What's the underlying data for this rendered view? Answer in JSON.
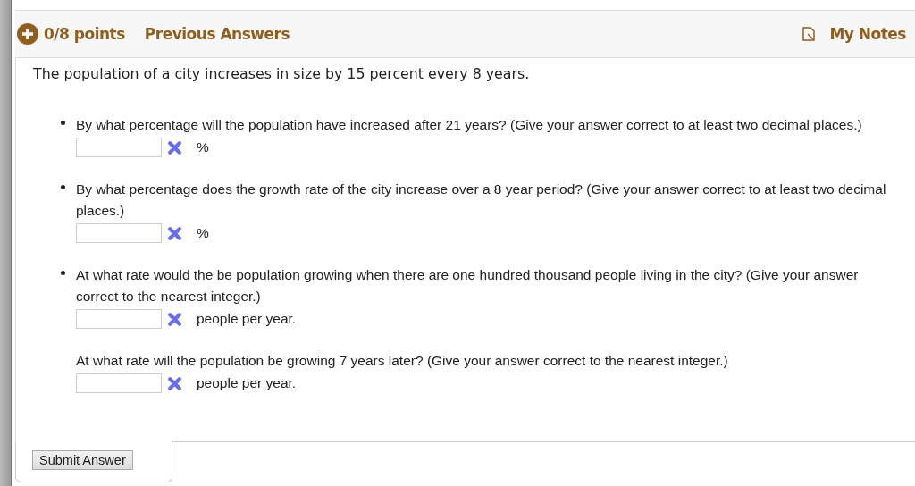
{
  "header": {
    "points": "0/8 points",
    "previous": "Previous Answers",
    "notes": "My Notes"
  },
  "intro": "The population of a city increases in size by 15 percent every 8 years.",
  "questions": [
    {
      "kind": "bullet",
      "text": "By what percentage will the population have increased after 21 years? (Give your answer correct to at least two decimal places.)",
      "unit": "%",
      "incorrect": true
    },
    {
      "kind": "bullet",
      "text": "By what percentage does the growth rate of the city increase over a 8 year period? (Give your answer correct to at least two decimal places.)",
      "unit": "%",
      "incorrect": true
    },
    {
      "kind": "bullet",
      "text": "At what rate would the be population growing when there are one hundred thousand people living in the city? (Give your answer correct to the nearest integer.)",
      "unit": "people per year.",
      "incorrect": true
    },
    {
      "kind": "plain",
      "text": "At what rate will the population be growing 7 years later? (Give your answer correct to the nearest integer.)",
      "unit": "people per year.",
      "incorrect": true
    }
  ],
  "submit": "Submit Answer"
}
